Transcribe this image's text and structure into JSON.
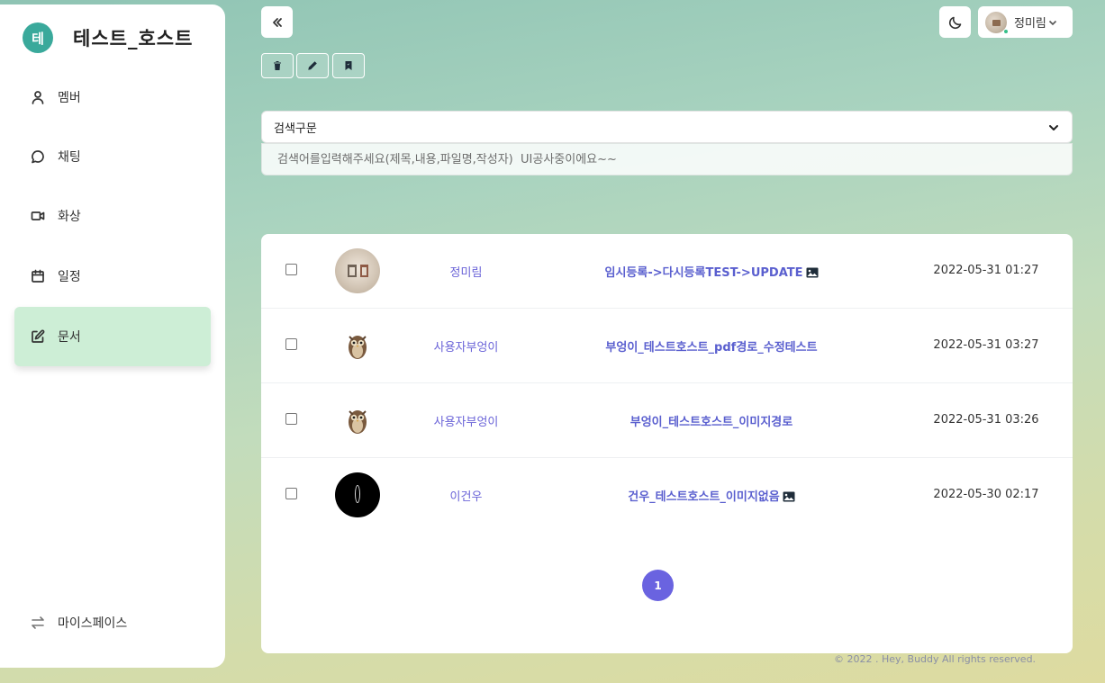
{
  "brand": {
    "badge": "테",
    "name": "테스트_호스트"
  },
  "sidebar": {
    "items": [
      {
        "label": "멤버",
        "icon": "user-icon"
      },
      {
        "label": "채팅",
        "icon": "chat-icon"
      },
      {
        "label": "화상",
        "icon": "video-icon"
      },
      {
        "label": "일정",
        "icon": "calendar-icon"
      },
      {
        "label": "문서",
        "icon": "edit-document-icon",
        "active": true
      }
    ],
    "bottom": {
      "label": "마이스페이스",
      "icon": "switch-arrows-icon"
    }
  },
  "toolbar": {
    "collapse_icon": "double-chevron-left-icon",
    "buttons": [
      "trash-icon",
      "pencil-icon",
      "bookmark-icon"
    ]
  },
  "header": {
    "theme_icon": "moon-icon",
    "user_name": "정미림"
  },
  "search": {
    "select_value": "검색구문",
    "placeholder": "검색어를입력해주세요(제목,내용,파일명,작성자)  UI공사중이에요~~"
  },
  "documents": [
    {
      "author": "정미림",
      "title": "임시등록->다시등록TEST->UPDATE",
      "has_image": true,
      "date": "2022-05-31 01:27",
      "avatar": "room"
    },
    {
      "author": "사용자부엉이",
      "title": "부엉이_테스트호스트_pdf경로_수정테스트",
      "has_image": false,
      "date": "2022-05-31 03:27",
      "avatar": "owl"
    },
    {
      "author": "사용자부엉이",
      "title": "부엉이_테스트호스트_이미지경로",
      "has_image": false,
      "date": "2022-05-31 03:26",
      "avatar": "owl"
    },
    {
      "author": "이건우",
      "title": "건우_테스트호스트_이미지없음",
      "has_image": true,
      "date": "2022-05-30 02:17",
      "avatar": "black"
    }
  ],
  "pagination": {
    "current": "1"
  },
  "footer": "© 2022 . Hey, Buddy All rights reserved.",
  "colors": {
    "accent": "#6a63e0",
    "active_nav": "#cdeed6",
    "brand_badge": "#3aa99b"
  }
}
